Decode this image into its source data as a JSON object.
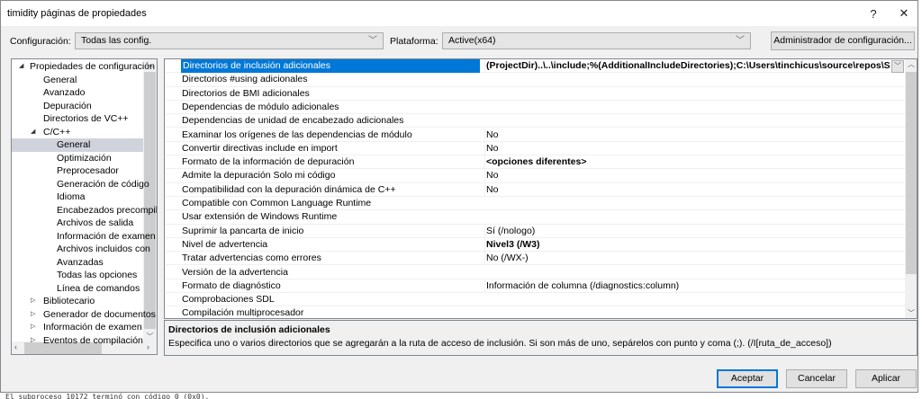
{
  "window": {
    "title": "timidity páginas de propiedades",
    "help": "?",
    "close": "✕"
  },
  "toolbar": {
    "config_label": "Configuración:",
    "config_value": "Todas las config.",
    "platform_label": "Plataforma:",
    "platform_value": "Active(x64)",
    "config_manager": "Administrador de configuración..."
  },
  "tree": [
    {
      "label": "Propiedades de configuración",
      "level": 0,
      "expander": "◢"
    },
    {
      "label": "General",
      "level": 1
    },
    {
      "label": "Avanzado",
      "level": 1
    },
    {
      "label": "Depuración",
      "level": 1
    },
    {
      "label": "Directorios de VC++",
      "level": 1
    },
    {
      "label": "C/C++",
      "level": 1,
      "expander": "◢"
    },
    {
      "label": "General",
      "level": 2,
      "selected": true
    },
    {
      "label": "Optimización",
      "level": 2
    },
    {
      "label": "Preprocesador",
      "level": 2
    },
    {
      "label": "Generación de código",
      "level": 2
    },
    {
      "label": "Idioma",
      "level": 2
    },
    {
      "label": "Encabezados precompilados",
      "level": 2
    },
    {
      "label": "Archivos de salida",
      "level": 2
    },
    {
      "label": "Información de examen",
      "level": 2
    },
    {
      "label": "Archivos incluidos con",
      "level": 2
    },
    {
      "label": "Avanzadas",
      "level": 2
    },
    {
      "label": "Todas las opciones",
      "level": 2
    },
    {
      "label": "Línea de comandos",
      "level": 2
    },
    {
      "label": "Bibliotecario",
      "level": 1,
      "expander": "▷"
    },
    {
      "label": "Generador de documentos",
      "level": 1,
      "expander": "▷"
    },
    {
      "label": "Información de examen",
      "level": 1,
      "expander": "▷"
    },
    {
      "label": "Eventos de compilación",
      "level": 1,
      "expander": "▷"
    }
  ],
  "properties": [
    {
      "name": "Directorios de inclusión adicionales",
      "value": "(ProjectDir)..\\..\\include;%(AdditionalIncludeDirectories);C:\\Users\\tinchicus\\source\\repos\\SDL\\include",
      "bold": true,
      "selected": true
    },
    {
      "name": "Directorios #using adicionales",
      "value": ""
    },
    {
      "name": "Directorios de BMI adicionales",
      "value": ""
    },
    {
      "name": "Dependencias de módulo adicionales",
      "value": ""
    },
    {
      "name": "Dependencias de unidad de encabezado adicionales",
      "value": ""
    },
    {
      "name": "Examinar los orígenes de las dependencias de módulo",
      "value": "No"
    },
    {
      "name": "Convertir directivas include en import",
      "value": "No"
    },
    {
      "name": "Formato de la información de depuración",
      "value": "<opciones diferentes>",
      "bold": true
    },
    {
      "name": "Admite la depuración Solo mi código",
      "value": "No"
    },
    {
      "name": "Compatibilidad con la depuración dinámica de C++",
      "value": "No"
    },
    {
      "name": "Compatible con Common Language Runtime",
      "value": ""
    },
    {
      "name": "Usar extensión de Windows Runtime",
      "value": ""
    },
    {
      "name": "Suprimir la pancarta de inicio",
      "value": "Sí (/nologo)"
    },
    {
      "name": "Nivel de advertencia",
      "value": "Nivel3 (/W3)",
      "bold": true
    },
    {
      "name": "Tratar advertencias como errores",
      "value": "No (/WX-)"
    },
    {
      "name": "Versión de la advertencia",
      "value": ""
    },
    {
      "name": "Formato de diagnóstico",
      "value": "Información de columna (/diagnostics:column)"
    },
    {
      "name": "Comprobaciones SDL",
      "value": ""
    },
    {
      "name": "Compilación multiprocesador",
      "value": ""
    }
  ],
  "description": {
    "title": "Directorios de inclusión adicionales",
    "text": "Especifica uno o varios directorios que se agregarán a la ruta de acceso de inclusión. Si son más de uno, sepárelos con punto y coma (;). (/I[ruta_de_acceso])"
  },
  "buttons": {
    "ok": "Aceptar",
    "cancel": "Cancelar",
    "apply": "Aplicar"
  },
  "background_output": "El subproceso 10172 terminó con código 0 (0x0)."
}
